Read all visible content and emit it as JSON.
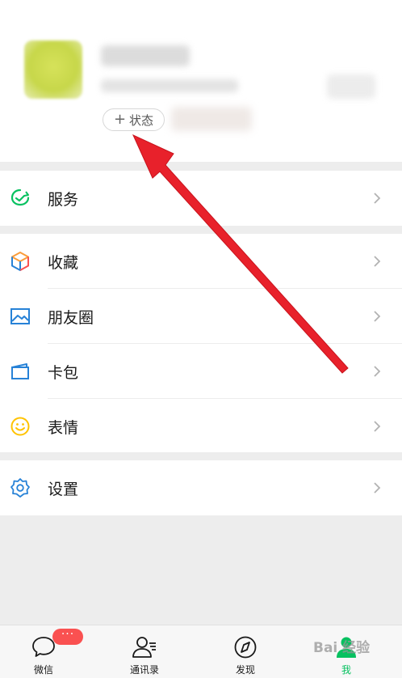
{
  "profile": {
    "status_plus": "+",
    "status_label": "状态"
  },
  "menu": {
    "services": {
      "label": "服务",
      "icon": "services-icon"
    },
    "favorites": {
      "label": "收藏",
      "icon": "favorites-cube-icon"
    },
    "moments": {
      "label": "朋友圈",
      "icon": "moments-image-icon"
    },
    "cards": {
      "label": "卡包",
      "icon": "card-wallet-icon"
    },
    "stickers": {
      "label": "表情",
      "icon": "smiley-icon"
    },
    "settings": {
      "label": "设置",
      "icon": "gear-icon"
    }
  },
  "tabbar": {
    "chats": {
      "label": "微信",
      "badge": "···"
    },
    "contacts": {
      "label": "通讯录"
    },
    "discover": {
      "label": "发现"
    },
    "me": {
      "label": "我"
    }
  },
  "watermark": {
    "text": "Bai 经验"
  },
  "colors": {
    "accent_green": "#07c160",
    "badge_red": "#fa5151",
    "annotation_arrow": "#e8212b",
    "background": "#ededed"
  }
}
